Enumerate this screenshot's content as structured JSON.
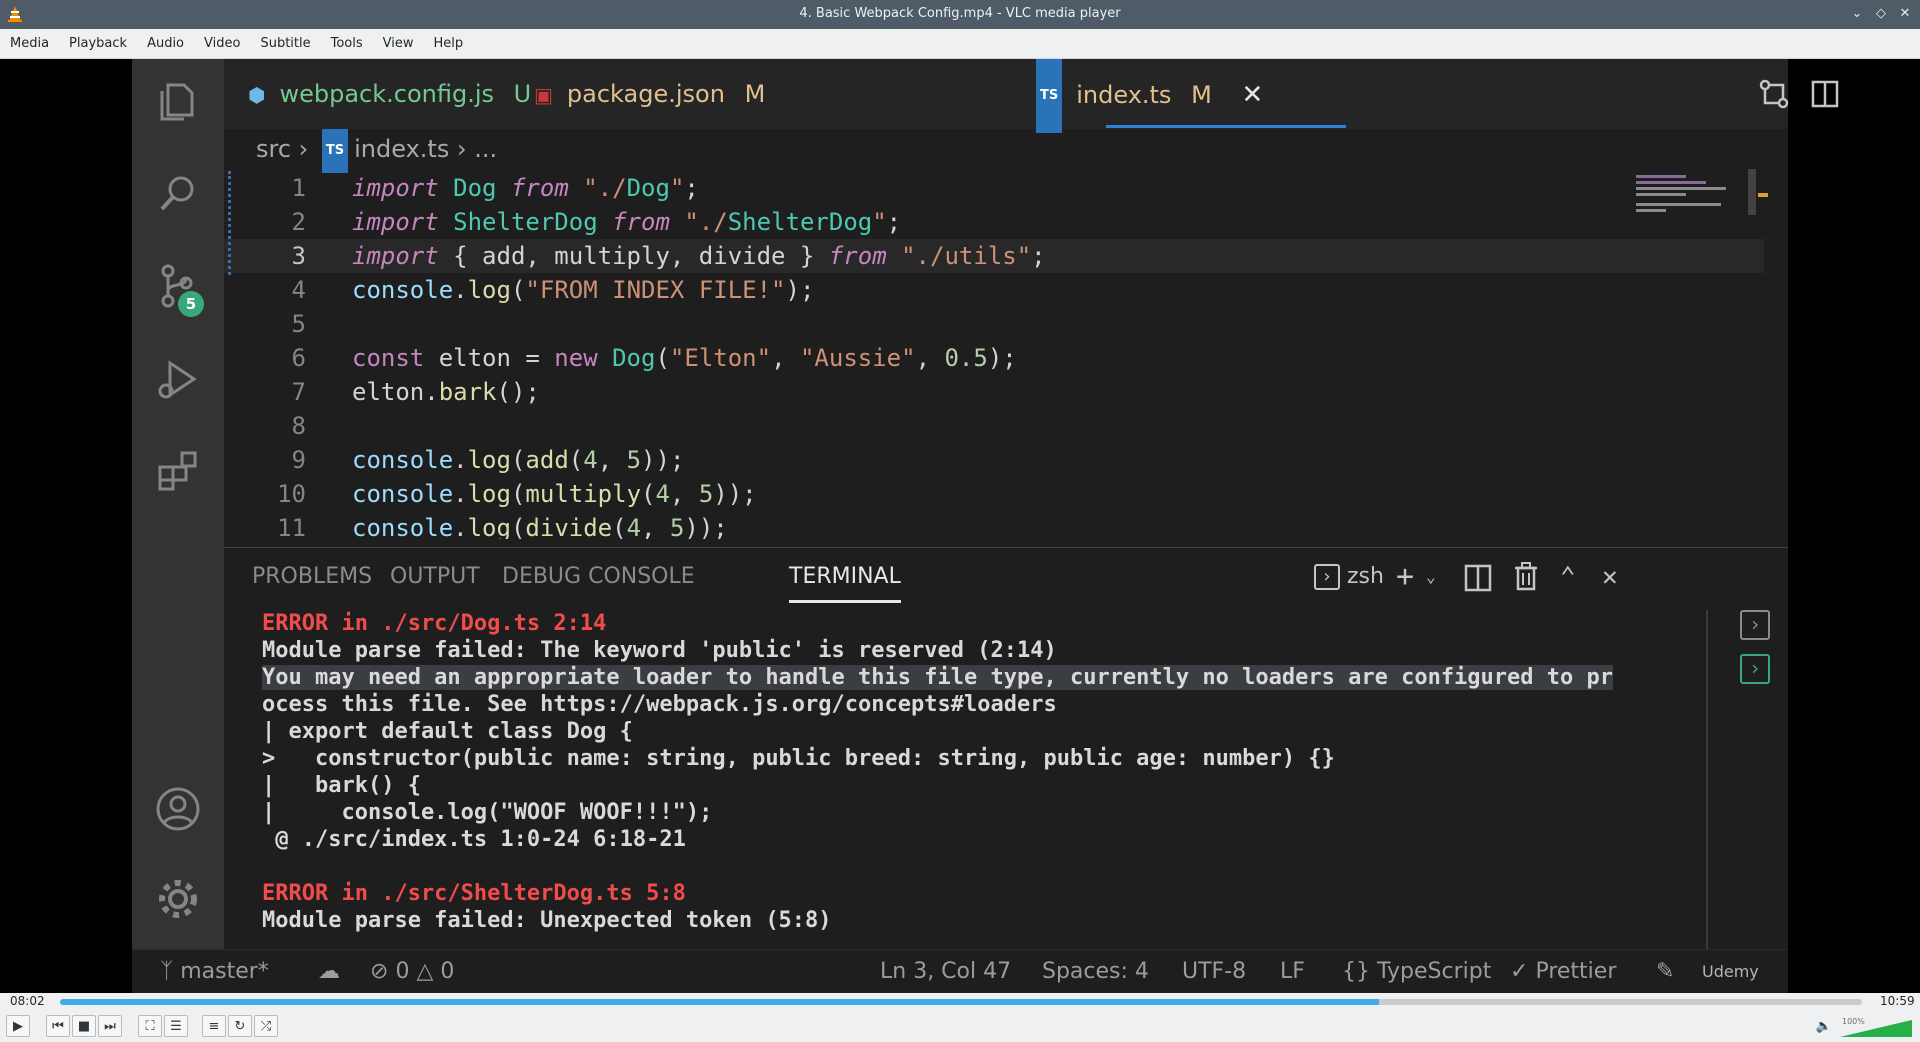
{
  "window": {
    "title": "4. Basic Webpack Config.mp4 - VLC media player"
  },
  "menu": [
    "Media",
    "Playback",
    "Audio",
    "Video",
    "Subtitle",
    "Tools",
    "View",
    "Help"
  ],
  "editor": {
    "tabs": [
      {
        "label": "webpack.config.js",
        "status": "U",
        "icon": "webpack-icon"
      },
      {
        "label": "package.json",
        "status": "M",
        "icon": "npm-icon"
      },
      {
        "label": "index.ts",
        "status": "M",
        "icon": "typescript-icon"
      }
    ],
    "breadcrumb": {
      "folder": "src",
      "file": "index.ts",
      "more": "..."
    },
    "scm_badge": "5",
    "code_lines": [
      {
        "n": "1",
        "text": "import Dog from \"./Dog\";"
      },
      {
        "n": "2",
        "text": "import ShelterDog from \"./ShelterDog\";"
      },
      {
        "n": "3",
        "text": "import { add, multiply, divide } from \"./utils\";"
      },
      {
        "n": "4",
        "text": "console.log(\"FROM INDEX FILE!\");"
      },
      {
        "n": "5",
        "text": ""
      },
      {
        "n": "6",
        "text": "const elton = new Dog(\"Elton\", \"Aussie\", 0.5);"
      },
      {
        "n": "7",
        "text": "elton.bark();"
      },
      {
        "n": "8",
        "text": ""
      },
      {
        "n": "9",
        "text": "console.log(add(4, 5));"
      },
      {
        "n": "10",
        "text": "console.log(multiply(4, 5));"
      },
      {
        "n": "11",
        "text": "console.log(divide(4, 5));"
      }
    ]
  },
  "panel": {
    "tabs": [
      "PROBLEMS",
      "OUTPUT",
      "DEBUG CONSOLE",
      "TERMINAL"
    ],
    "active_tab": "TERMINAL",
    "shell": "zsh",
    "terminal_lines": [
      "ERROR in ./src/Dog.ts 2:14",
      "Module parse failed: The keyword 'public' is reserved (2:14)",
      "You may need an appropriate loader to handle this file type, currently no loaders are configured to pr",
      "ocess this file. See https://webpack.js.org/concepts#loaders",
      "| export default class Dog {",
      ">   constructor(public name: string, public breed: string, public age: number) {}",
      "|   bark() {",
      "|     console.log(\"WOOF WOOF!!!\");",
      " @ ./src/index.ts 1:0-24 6:18-21",
      "",
      "ERROR in ./src/ShelterDog.ts 5:8",
      "Module parse failed: Unexpected token (5:8)"
    ]
  },
  "statusbar": {
    "branch": "master*",
    "errors": "0",
    "warnings": "0",
    "position": "Ln 3, Col 47",
    "spaces": "Spaces: 4",
    "encoding": "UTF-8",
    "eol": "LF",
    "language": "TypeScript",
    "formatter": "Prettier",
    "watermark": "Udemy"
  },
  "player": {
    "elapsed": "08:02",
    "total": "10:59",
    "progress": 0.732,
    "volume_label": "100%",
    "volume": 1.0
  },
  "colors": {
    "titlebar": "#4f5b66",
    "accent": "#3daee9",
    "error": "#f14c4c"
  }
}
